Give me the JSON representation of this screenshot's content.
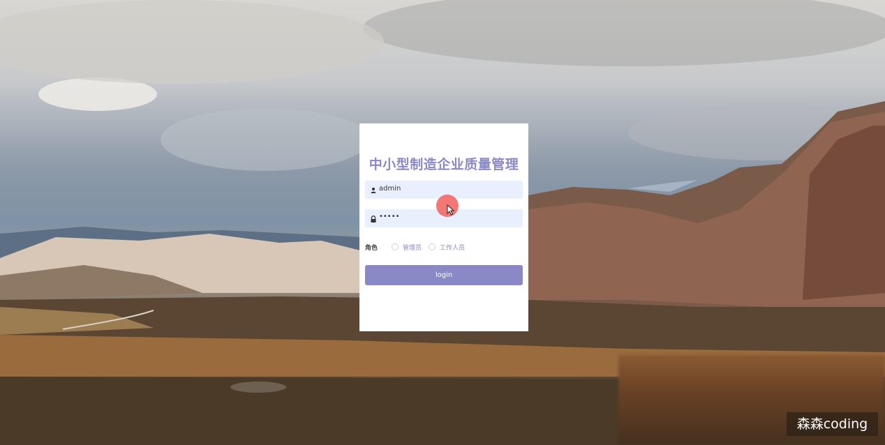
{
  "title": "中小型制造企业质量管理",
  "username": {
    "icon": "user-icon",
    "value": "admin"
  },
  "password": {
    "icon": "lock-icon",
    "value": "•••••"
  },
  "role": {
    "label": "角色",
    "options": [
      "管理员",
      "工作人员"
    ]
  },
  "login_button": "login",
  "watermark": "森森coding",
  "colors": {
    "accent": "#8a88c6",
    "field_bg": "#e8f0fe",
    "cursor_highlight": "#f25f5c"
  }
}
